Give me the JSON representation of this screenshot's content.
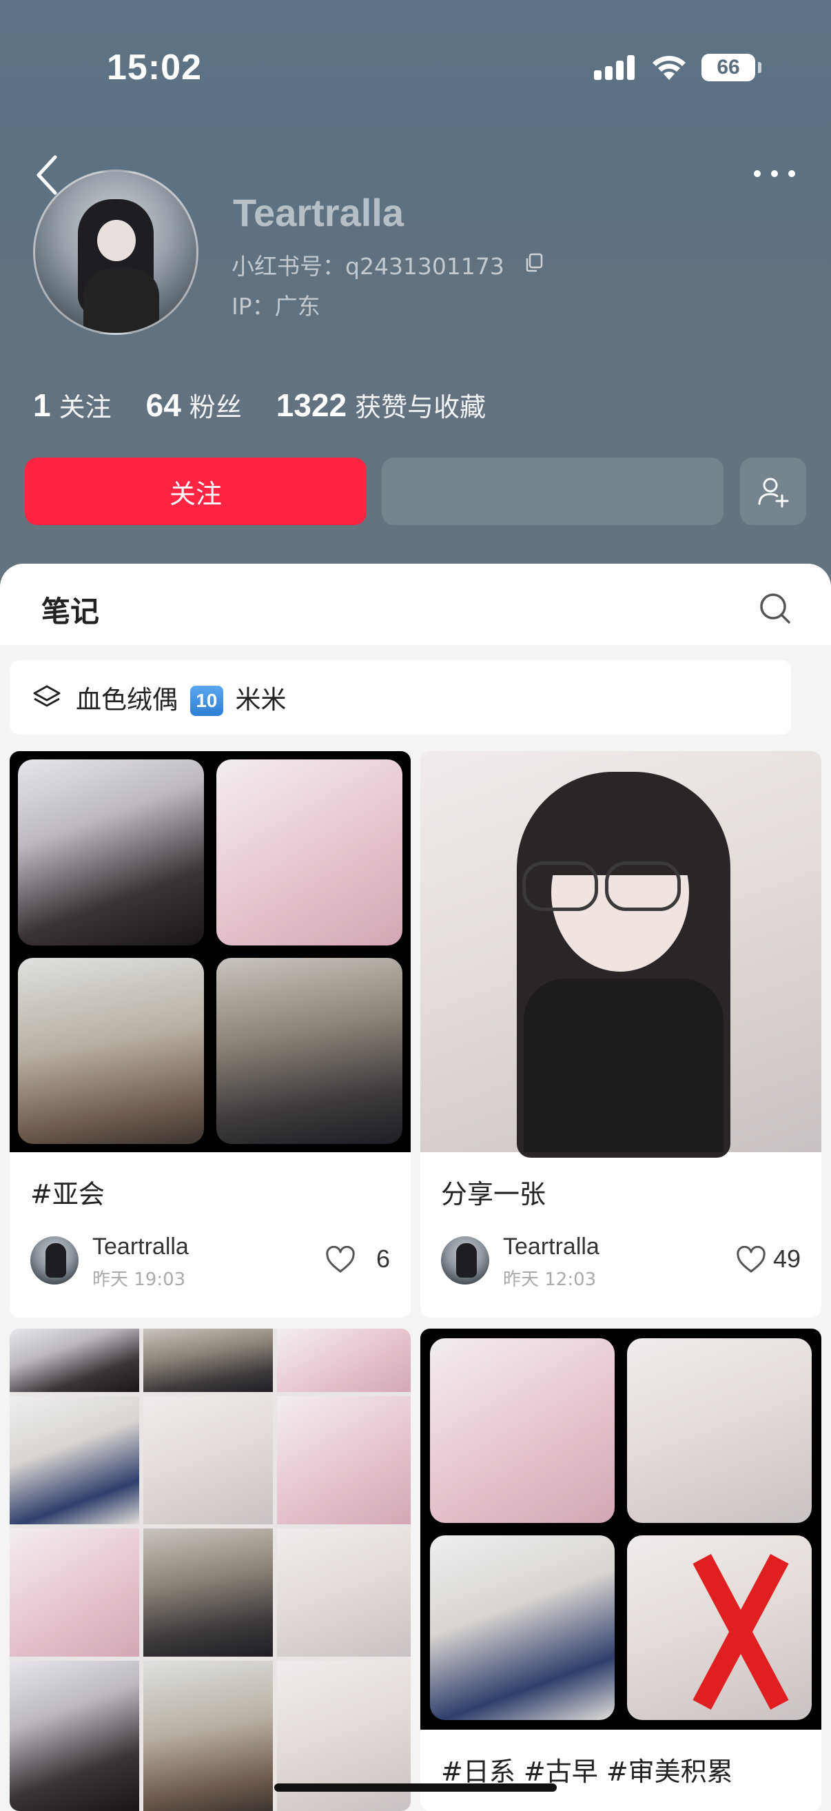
{
  "status_bar": {
    "time": "15:02",
    "battery": "66"
  },
  "profile": {
    "name": "Teartralla",
    "xhs_id": "小红书号：q2431301173",
    "ip": "IP：广东"
  },
  "stats": [
    {
      "num": "1",
      "label": "关注"
    },
    {
      "num": "64",
      "label": "粉丝"
    },
    {
      "num": "1322",
      "label": "获赞与收藏"
    }
  ],
  "actions": {
    "follow_label": "关注"
  },
  "tabs": {
    "notes_label": "笔记"
  },
  "collection": {
    "prefix": "血色绒偶",
    "badge": "10",
    "suffix": "米米"
  },
  "notes": [
    {
      "title": "#亚会",
      "author": "Teartralla",
      "time": "昨天 19:03",
      "likes": "6"
    },
    {
      "title": "分享一张",
      "author": "Teartralla",
      "time": "昨天 12:03",
      "likes": "49"
    },
    {
      "title": "",
      "author": "",
      "time": "",
      "likes": ""
    },
    {
      "title": "#日系 #古早 #审美积累",
      "author": "",
      "time": "",
      "likes": ""
    }
  ],
  "colors": {
    "accent": "#ff2442",
    "header_bg": "#5f7180",
    "page_bg": "#f4f4f4"
  }
}
